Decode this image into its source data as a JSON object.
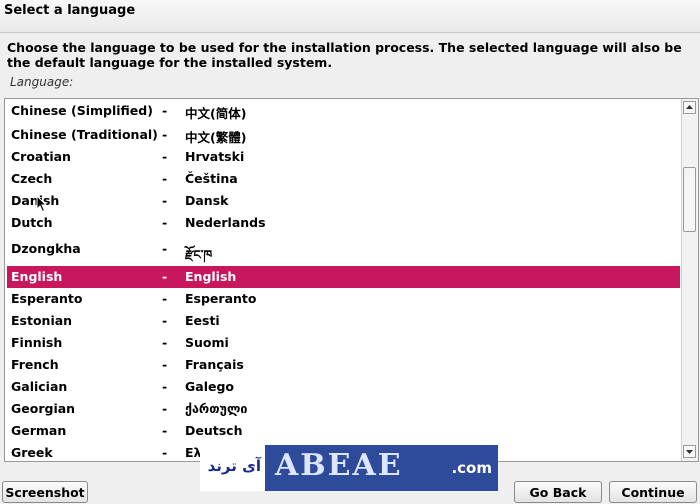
{
  "window": {
    "title": "Select a language"
  },
  "description": "Choose the language to be used for the installation process. The selected language will also be the default language for the installed system.",
  "list_label": "Language:",
  "languages": [
    {
      "name": "Chinese (Simplified)",
      "native": "中文(简体)"
    },
    {
      "name": "Chinese (Traditional)",
      "native": "中文(繁體)"
    },
    {
      "name": "Croatian",
      "native": "Hrvatski"
    },
    {
      "name": "Czech",
      "native": "Čeština"
    },
    {
      "name": "Danish",
      "native": "Dansk"
    },
    {
      "name": "Dutch",
      "native": "Nederlands"
    },
    {
      "name": "Dzongkha",
      "native": "རྫོང་ཁ"
    },
    {
      "name": "English",
      "native": "English",
      "selected": true
    },
    {
      "name": "Esperanto",
      "native": "Esperanto"
    },
    {
      "name": "Estonian",
      "native": "Eesti"
    },
    {
      "name": "Finnish",
      "native": "Suomi"
    },
    {
      "name": "French",
      "native": "Français"
    },
    {
      "name": "Galician",
      "native": "Galego"
    },
    {
      "name": "Georgian",
      "native": "ქართული"
    },
    {
      "name": "German",
      "native": "Deutsch"
    },
    {
      "name": "Greek",
      "native": "Ελληνικά"
    }
  ],
  "separator": "-",
  "accent_color": "#c8175d",
  "buttons": {
    "screenshot": "Screenshot",
    "back": "Go Back",
    "continue": "Continue"
  },
  "watermark": {
    "left_text": "آی ترند",
    "right_text": "ABEAE",
    "suffix": ".com"
  }
}
